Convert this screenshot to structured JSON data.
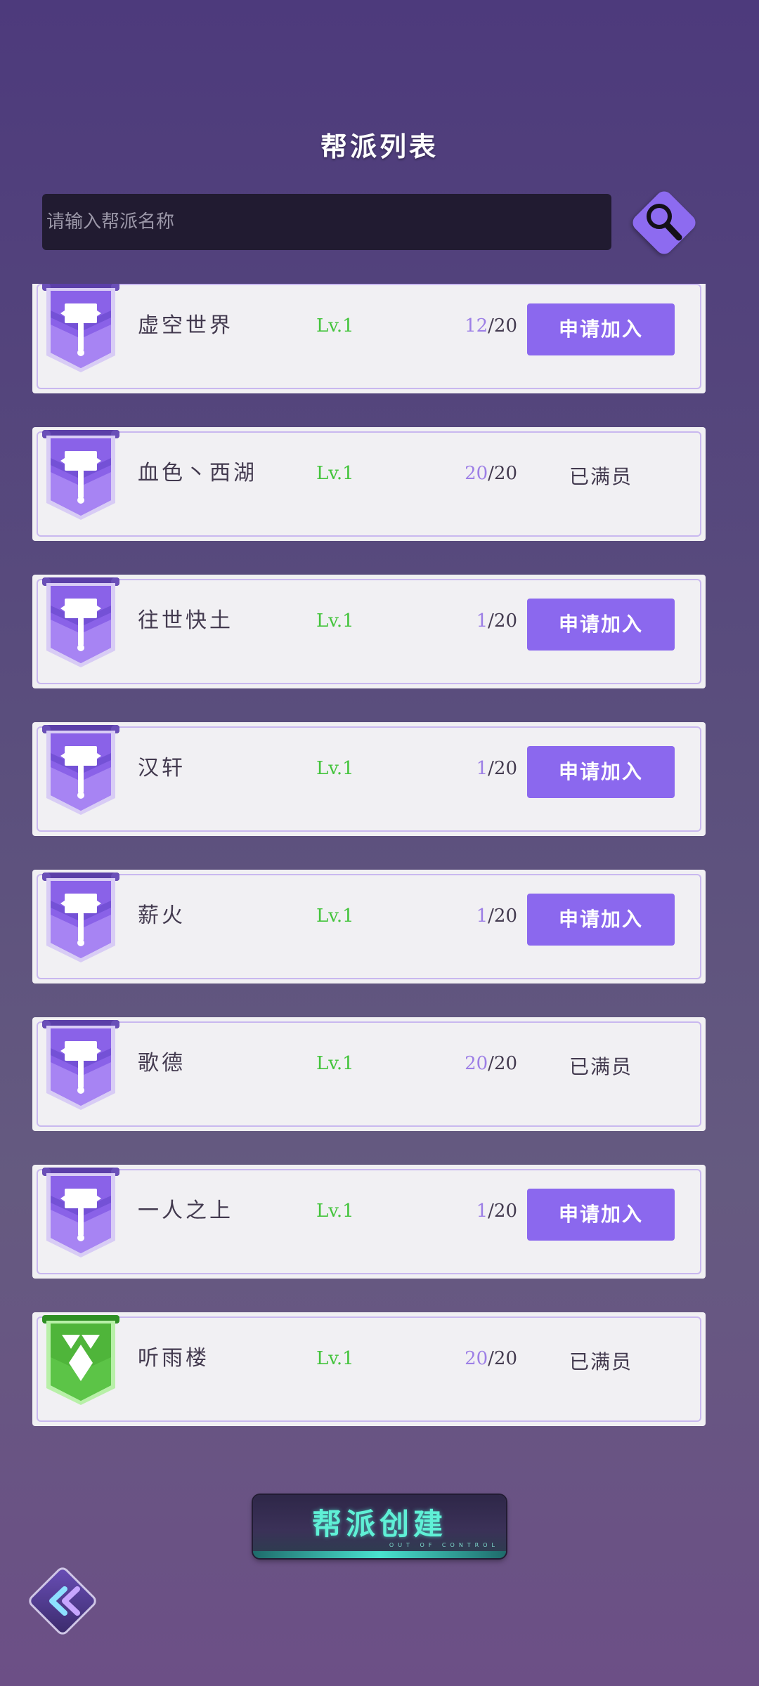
{
  "title": "帮派列表",
  "search": {
    "placeholder": "请输入帮派名称",
    "button_icon": "magnifier-icon"
  },
  "guilds": [
    {
      "name": "虚空世界",
      "level": "Lv.1",
      "current": "12",
      "max": "/20",
      "action": "申请加入",
      "full": false,
      "emblem": "hammer-emblem-icon"
    },
    {
      "name": "血色丶西湖",
      "level": "Lv.1",
      "current": "20",
      "max": "/20",
      "action": "已满员",
      "full": true,
      "emblem": "hammer-emblem-icon"
    },
    {
      "name": "往世快土",
      "level": "Lv.1",
      "current": "1",
      "max": "/20",
      "action": "申请加入",
      "full": false,
      "emblem": "hammer-emblem-icon"
    },
    {
      "name": "汉轩",
      "level": "Lv.1",
      "current": "1",
      "max": "/20",
      "action": "申请加入",
      "full": false,
      "emblem": "hammer-emblem-icon"
    },
    {
      "name": "薪火",
      "level": "Lv.1",
      "current": "1",
      "max": "/20",
      "action": "申请加入",
      "full": false,
      "emblem": "hammer-emblem-icon"
    },
    {
      "name": "歌德",
      "level": "Lv.1",
      "current": "20",
      "max": "/20",
      "action": "已满员",
      "full": true,
      "emblem": "hammer-emblem-icon"
    },
    {
      "name": "一人之上",
      "level": "Lv.1",
      "current": "1",
      "max": "/20",
      "action": "申请加入",
      "full": false,
      "emblem": "hammer-emblem-icon"
    },
    {
      "name": "听雨楼",
      "level": "Lv.1",
      "current": "20",
      "max": "/20",
      "action": "已满员",
      "full": true,
      "emblem": "diamond-emblem-icon"
    }
  ],
  "create_button": {
    "label": "帮派创建",
    "subtitle": "OUT OF CONTROL"
  },
  "back_button": {
    "icon": "double-chevron-left-icon"
  },
  "colors": {
    "accent": "#8b68ee",
    "level_green": "#45c43d",
    "count_purple": "#9d7fe6",
    "emblem_green": "#4fb53a"
  }
}
